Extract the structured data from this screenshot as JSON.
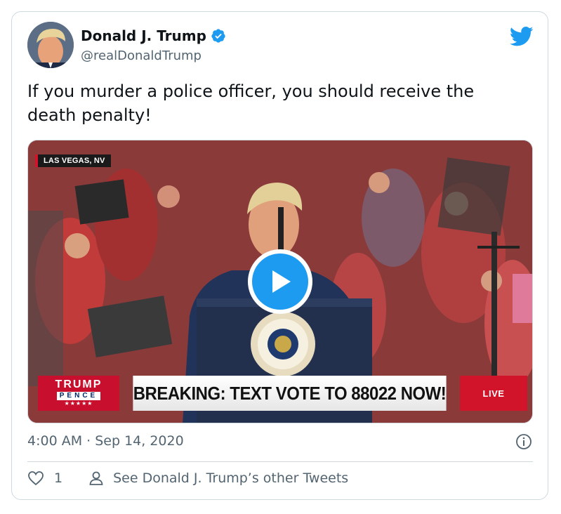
{
  "user": {
    "name": "Donald J. Trump",
    "handle": "@realDonaldTrump",
    "verified": true,
    "avatar": "profile-photo"
  },
  "tweet": {
    "text": "If you murder a police officer, you should receive the\ndeath penalty!",
    "timestamp": "4:00 AM · Sep 14, 2020"
  },
  "media": {
    "type": "video",
    "location_tag": "LAS VEGAS, NV",
    "ticker": {
      "brand_top": "TRUMP",
      "brand_mid": "PENCE",
      "brand_stars": "★★★★★",
      "text": "BREAKING: TEXT VOTE TO 88022 NOW!",
      "live": "LIVE"
    },
    "seal_text": "PRESIDENT OF THE UNITED STATES"
  },
  "footer": {
    "like_count": "1",
    "other_tweets_link": "See Donald J. Trump’s other Tweets"
  },
  "colors": {
    "brand_blue": "#1d9bf0",
    "text_primary": "#0f1419",
    "text_secondary": "#536471",
    "border": "#cfd9de",
    "live_red": "#d2142b"
  }
}
